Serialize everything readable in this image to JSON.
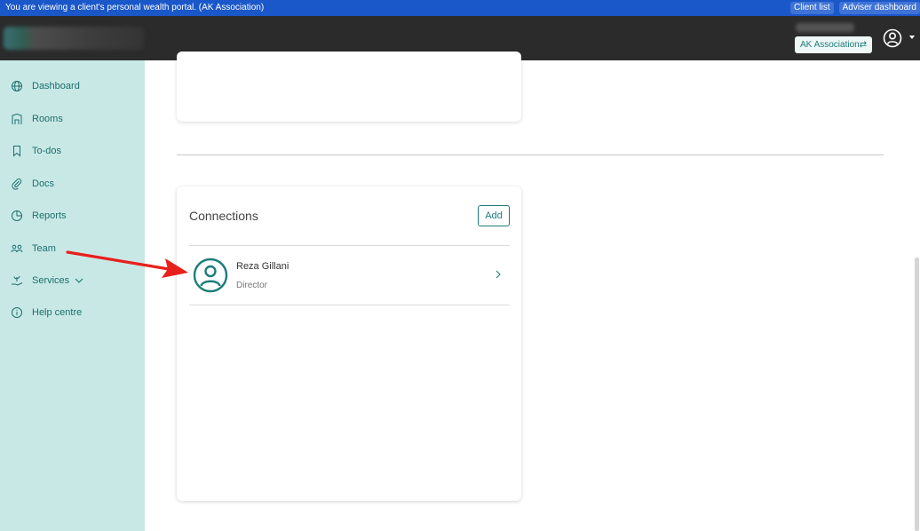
{
  "banner": {
    "message": "You are viewing a client's personal wealth portal. (AK Association)",
    "links": [
      "Client list",
      "Adviser dashboard"
    ]
  },
  "header": {
    "client_switch_label": "AK Association",
    "client_switch_icon": "swap-icon",
    "account_icon": "user-circle-icon"
  },
  "sidebar": {
    "items": [
      {
        "label": "Dashboard",
        "icon": "globe-icon"
      },
      {
        "label": "Rooms",
        "icon": "building-icon"
      },
      {
        "label": "To-dos",
        "icon": "bookmark-icon"
      },
      {
        "label": "Docs",
        "icon": "paperclip-icon"
      },
      {
        "label": "Reports",
        "icon": "pie-chart-icon"
      },
      {
        "label": "Team",
        "icon": "team-icon"
      },
      {
        "label": "Services",
        "icon": "hand-plant-icon"
      },
      {
        "label": "Help centre",
        "icon": "info-icon"
      }
    ]
  },
  "connections": {
    "title": "Connections",
    "add_label": "Add",
    "items": [
      {
        "name": "Reza Gillani",
        "role": "Director"
      }
    ]
  },
  "colors": {
    "banner": "#1a57c9",
    "topbar": "#2b2b2b",
    "sidebar": "#c8e8e6",
    "accent": "#1d7d7a",
    "arrow": "#e8201c"
  }
}
